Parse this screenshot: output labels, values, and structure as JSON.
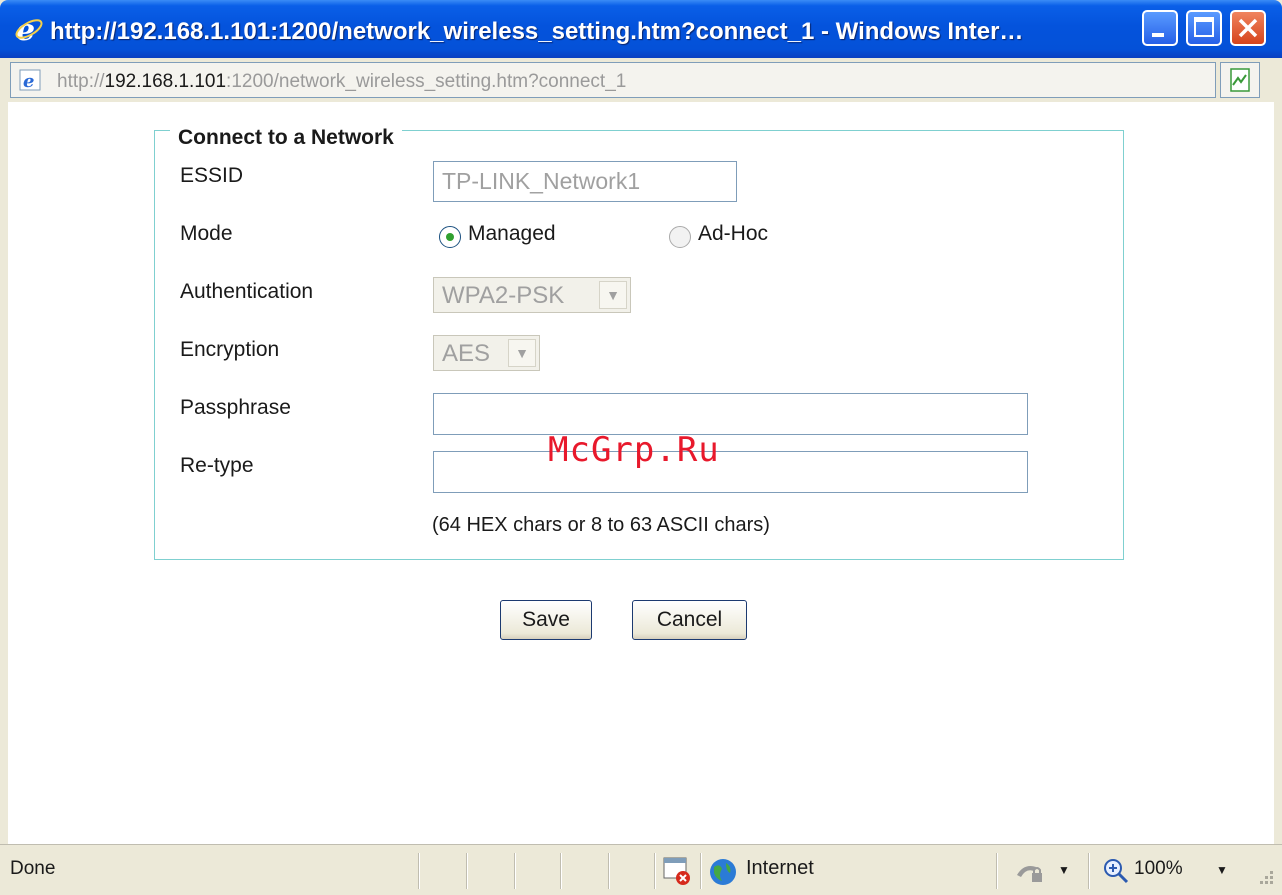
{
  "window": {
    "title": "http://192.168.1.101:1200/network_wireless_setting.htm?connect_1 - Windows Inter…"
  },
  "address": {
    "scheme": "http://",
    "host": "192.168.1.101",
    "rest": ":1200/network_wireless_setting.htm?connect_1"
  },
  "form": {
    "legend": "Connect to a Network",
    "essid_label": "ESSID",
    "essid_value": "TP-LINK_Network1",
    "mode_label": "Mode",
    "mode_options": [
      "Managed",
      "Ad-Hoc"
    ],
    "mode_selected": "Managed",
    "auth_label": "Authentication",
    "auth_value": "WPA2-PSK",
    "enc_label": "Encryption",
    "enc_value": "AES",
    "pass_label": "Passphrase",
    "pass_value": "",
    "retype_label": "Re-type",
    "retype_value": "",
    "hint": "(64 HEX chars or 8 to 63 ASCII chars)"
  },
  "buttons": {
    "save": "Save",
    "cancel": "Cancel"
  },
  "watermark": "McGrp.Ru",
  "status": {
    "text": "Done",
    "zone": "Internet",
    "zoom": "100%"
  },
  "colors": {
    "titlebar": "#0453dc",
    "fieldset_border": "#7fd0d0",
    "watermark": "#e8192c"
  },
  "icons": {
    "title": "ie-logo-icon",
    "address": "ie-page-icon",
    "compat": "compatibility-view-icon",
    "zone": "globe-icon",
    "zoom": "zoom-icon"
  }
}
